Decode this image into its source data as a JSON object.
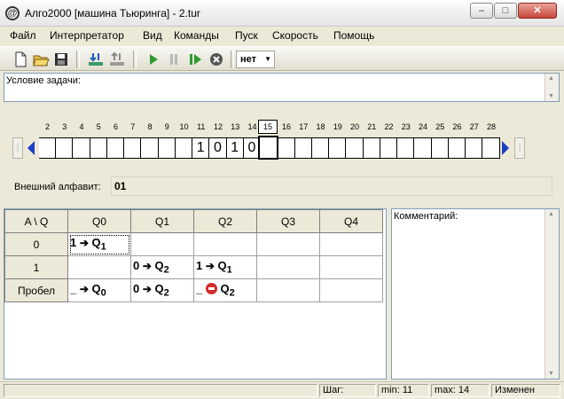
{
  "window": {
    "title": "Алго2000 [машина Тьюринга] - 2.tur",
    "app_icon": "@",
    "min_glyph": "–",
    "max_glyph": "□",
    "close_glyph": "✕"
  },
  "menu": [
    "Файл",
    "Интерпретатор",
    "Вид",
    "Команды",
    "Пуск",
    "Скорость",
    "Помощь"
  ],
  "toolbar": {
    "speed_value": "нет",
    "icons": [
      "new-file-icon",
      "open-folder-icon",
      "save-icon",
      "load-tape-icon",
      "save-tape-icon",
      "run-icon",
      "pause-icon",
      "step-icon",
      "stop-icon"
    ]
  },
  "task": {
    "label": "Условие задачи:",
    "scroll_up": "▲",
    "scroll_down": "▼"
  },
  "tape": {
    "numbers": [
      "2",
      "3",
      "4",
      "5",
      "6",
      "7",
      "8",
      "9",
      "10",
      "11",
      "12",
      "13",
      "14",
      "15",
      "16",
      "17",
      "18",
      "19",
      "20",
      "21",
      "22",
      "23",
      "24",
      "25",
      "26",
      "27",
      "28"
    ],
    "current_index": "15",
    "cells": [
      "",
      "",
      "",
      "",
      "",
      "",
      "",
      "",
      "",
      "1",
      "0",
      "1",
      "0",
      "",
      "",
      "",
      "",
      "",
      "",
      "",
      "",
      "",
      "",
      "",
      "",
      "",
      ""
    ],
    "left_end": "|",
    "right_end": "|"
  },
  "alphabet": {
    "label": "Внешний алфавит:",
    "value": "01"
  },
  "program": {
    "corner": "A \\ Q",
    "states": [
      "Q0",
      "Q1",
      "Q2",
      "Q3",
      "Q4"
    ],
    "rows": [
      {
        "symbol": "0",
        "cells": [
          {
            "write": "1",
            "dir": "➔",
            "state": "Q",
            "sub": "1"
          },
          null,
          null,
          null,
          null
        ]
      },
      {
        "symbol": "1",
        "cells": [
          null,
          {
            "write": "0",
            "dir": "➔",
            "state": "Q",
            "sub": "2"
          },
          {
            "write": "1",
            "dir": "➔",
            "state": "Q",
            "sub": "1"
          },
          null,
          null
        ]
      },
      {
        "symbol": "Пробел",
        "cells": [
          {
            "write": "_",
            "dir": "➔",
            "state": "Q",
            "sub": "0"
          },
          {
            "write": "0",
            "dir": "➔",
            "state": "Q",
            "sub": "2"
          },
          {
            "write": "_",
            "dir": "stop",
            "state": "Q",
            "sub": "2"
          },
          null,
          null
        ]
      }
    ]
  },
  "comment": {
    "label": "Комментарий:",
    "scroll_up": "▲",
    "scroll_down": "▼"
  },
  "status": {
    "step": "Шаг:",
    "min": "min: 11",
    "max": "max: 14",
    "state": "Изменен"
  }
}
